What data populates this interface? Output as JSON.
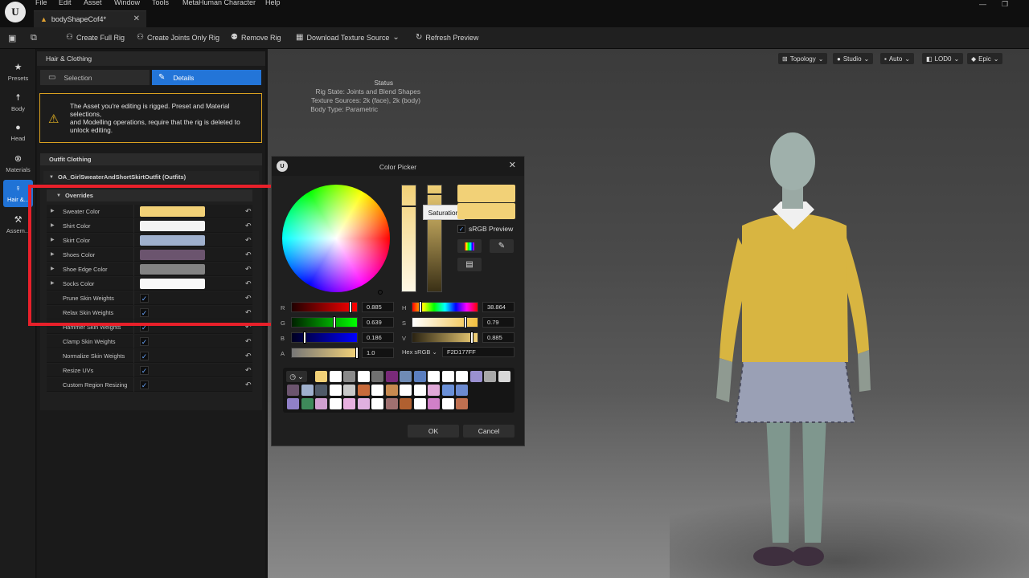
{
  "menu": [
    "File",
    "Edit",
    "Asset",
    "Window",
    "Tools",
    "MetaHuman Character",
    "Help"
  ],
  "logo": "U",
  "tab": {
    "title": "bodyShapeCof4*",
    "close": "✕"
  },
  "window_controls": {
    "minimize": "—",
    "restore": "❐"
  },
  "toolbar": {
    "create_full_rig": "Create Full Rig",
    "create_joints_only_rig": "Create Joints Only Rig",
    "remove_rig": "Remove Rig",
    "download_texture_source": "Download Texture Source",
    "refresh_preview": "Refresh Preview"
  },
  "rail": [
    {
      "label": "Presets",
      "icon": "star-icon"
    },
    {
      "label": "Body",
      "icon": "body-icon"
    },
    {
      "label": "Head",
      "icon": "head-icon"
    },
    {
      "label": "Materials",
      "icon": "materials-icon"
    },
    {
      "label": "Hair &...",
      "icon": "hair-icon"
    },
    {
      "label": "Assem...",
      "icon": "hammer-icon"
    }
  ],
  "panel": {
    "title": "Hair & Clothing",
    "selection_label": "Selection",
    "details_label": "Details",
    "warning": "The Asset you're editing is rigged. Preset and Material selections,\nand Modelling operations, require that the rig is deleted to unlock editing.",
    "outfit_header": "Outfit Clothing",
    "outfit_asset": "OA_GirlSweaterAndShortSkirtOutfit (Outfits)",
    "overrides_header": "Overrides"
  },
  "color_rows": [
    {
      "label": "Sweater Color",
      "color": "#f2d177"
    },
    {
      "label": "Shirt Color",
      "color": "#f4f4f4"
    },
    {
      "label": "Skirt Color",
      "color": "#9fb0cd"
    },
    {
      "label": "Shoes Color",
      "color": "#6b546e"
    },
    {
      "label": "Shoe Edge Color",
      "color": "#838383"
    },
    {
      "label": "Socks Color",
      "color": "#f8f8f8"
    }
  ],
  "bool_rows": [
    {
      "label": "Prune Skin Weights",
      "checked": true
    },
    {
      "label": "Relax Skin Weights",
      "checked": true
    },
    {
      "label": "Hammer Skin Weights",
      "checked": true
    },
    {
      "label": "Clamp Skin Weights",
      "checked": true
    },
    {
      "label": "Normalize Skin Weights",
      "checked": true
    },
    {
      "label": "Resize UVs",
      "checked": true
    },
    {
      "label": "Custom Region Resizing",
      "checked": true
    }
  ],
  "viewport": {
    "buttons": [
      "Topology",
      "Studio",
      "Auto",
      "LOD0",
      "Epic"
    ],
    "status_title": "Status",
    "rig_state": "Rig State: Joints and Blend Shapes",
    "texture_sources": "Texture Sources: 2k (face), 2k (body)",
    "body_type": "Body Type: Parametric"
  },
  "picker": {
    "title": "Color Picker",
    "tooltip": "Saturation",
    "srgb_preview": "sRGB Preview",
    "r_label": "R",
    "g_label": "G",
    "b_label": "B",
    "a_label": "A",
    "h_label": "H",
    "s_label": "S",
    "v_label": "V",
    "r": "0.885",
    "g": "0.639",
    "b": "0.186",
    "a": "1.0",
    "h": "38.864",
    "s": "0.79",
    "v": "0.885",
    "hex_label": "Hex sRGB",
    "hex": "F2D177FF",
    "ok": "OK",
    "cancel": "Cancel",
    "current_color": "#f2d177",
    "palette_row1": [
      "#f2d177",
      "#ffffff",
      "#8a8a8a",
      "#ffffff",
      "#707070",
      "#7a2a7a",
      "#6f8bb5",
      "#5b7fc0",
      "#ffffff",
      "#ffffff",
      "#ffffff",
      "#9a90d0",
      "#a8a8a8",
      "#d8d8d8"
    ],
    "palette_row2": [
      "#6b546e",
      "#9fb0cd",
      "#4f5a68",
      "#ffffff",
      "#c8c8c8",
      "#c86a3a",
      "#ffffff",
      "#c88a50",
      "#ffffff",
      "#ffffff",
      "#e0a8d8",
      "#6a90d8",
      "#6b8ad0"
    ],
    "palette_row3": [
      "#9080c8",
      "#3e8a5a",
      "#d0a0d0",
      "#ffffff",
      "#e8b0e0",
      "#e0b0e0",
      "#ffffff",
      "#a07070",
      "#b06030",
      "#ffffff",
      "#d080c8",
      "#ffffff",
      "#c07050"
    ]
  }
}
